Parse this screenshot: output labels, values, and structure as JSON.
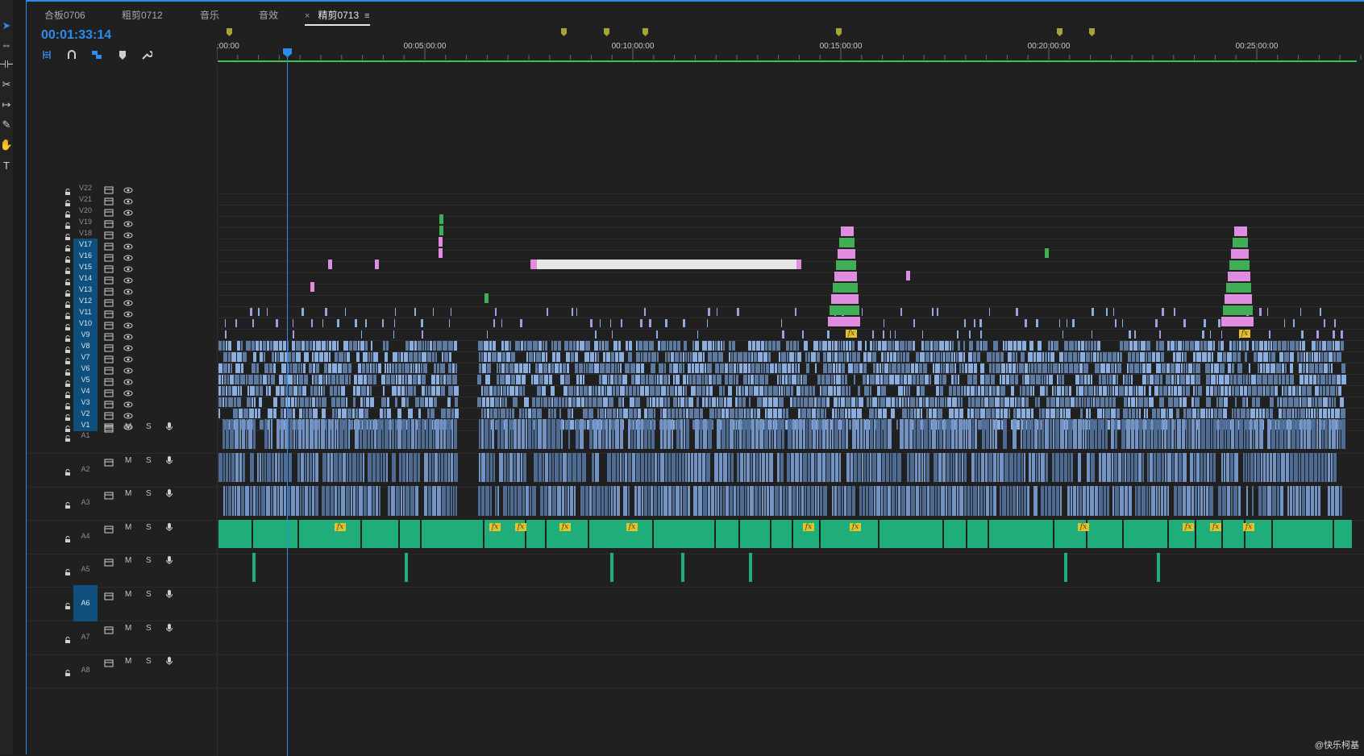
{
  "tools": [
    {
      "name": "selection-tool-icon",
      "glyph": "➤"
    },
    {
      "name": "track-select-tool-icon",
      "glyph": "⇔"
    },
    {
      "name": "ripple-edit-tool-icon",
      "glyph": "⊣⊢"
    },
    {
      "name": "razor-tool-icon",
      "glyph": "✂"
    },
    {
      "name": "slip-tool-icon",
      "glyph": "↦"
    },
    {
      "name": "pen-tool-icon",
      "glyph": "✎"
    },
    {
      "name": "hand-tool-icon",
      "glyph": "✋"
    },
    {
      "name": "type-tool-icon",
      "glyph": "T"
    }
  ],
  "tabs": [
    {
      "label": "合板0706",
      "active": false
    },
    {
      "label": "粗剪0712",
      "active": false
    },
    {
      "label": "音乐",
      "active": false
    },
    {
      "label": "音效",
      "active": false
    },
    {
      "label": "精剪0713",
      "active": true
    }
  ],
  "tab_close": "×",
  "tab_menu": "≡",
  "timecode": "00:01:33:14",
  "ruler_labels": [
    ":00:00",
    "00:05:00:00",
    "00:10:00:00",
    "00:15:00:00",
    "00:20:00:00",
    "00:25:00:00"
  ],
  "video_tracks": [
    {
      "label": "V22",
      "targeted": false
    },
    {
      "label": "V21",
      "targeted": false
    },
    {
      "label": "V20",
      "targeted": false
    },
    {
      "label": "V19",
      "targeted": false
    },
    {
      "label": "V18",
      "targeted": false
    },
    {
      "label": "V17",
      "targeted": true
    },
    {
      "label": "V16",
      "targeted": true
    },
    {
      "label": "V15",
      "targeted": true
    },
    {
      "label": "V14",
      "targeted": true
    },
    {
      "label": "V13",
      "targeted": true
    },
    {
      "label": "V12",
      "targeted": true
    },
    {
      "label": "V11",
      "targeted": true
    },
    {
      "label": "V10",
      "targeted": true
    },
    {
      "label": "V9",
      "targeted": true
    },
    {
      "label": "V8",
      "targeted": true
    },
    {
      "label": "V7",
      "targeted": true
    },
    {
      "label": "V6",
      "targeted": true
    },
    {
      "label": "V5",
      "targeted": true
    },
    {
      "label": "V4",
      "targeted": true
    },
    {
      "label": "V3",
      "targeted": true
    },
    {
      "label": "V2",
      "targeted": true
    },
    {
      "label": "V1",
      "targeted": true
    }
  ],
  "audio_tracks": [
    {
      "label": "A1",
      "targeted": false
    },
    {
      "label": "A2",
      "targeted": false
    },
    {
      "label": "A3",
      "targeted": false
    },
    {
      "label": "A4",
      "targeted": false
    },
    {
      "label": "A5",
      "targeted": false
    },
    {
      "label": "A6",
      "targeted": true
    },
    {
      "label": "A7",
      "targeted": false
    },
    {
      "label": "A8",
      "targeted": false
    }
  ],
  "audio_buttons": {
    "mute": "M",
    "solo": "S"
  },
  "fx_label": "fx",
  "watermark": "@快乐柯基",
  "colors": {
    "accent": "#2d8ceb",
    "video_clip": "#7ea3d6",
    "audio_clip": "#6e8fbd",
    "music_clip": "#1fae7a",
    "adjustment": "#e08ce0",
    "title": "#e6e6e6",
    "marker": "#a5a339",
    "green_bar": "#3ec44a",
    "target": "#0f4f7c"
  }
}
